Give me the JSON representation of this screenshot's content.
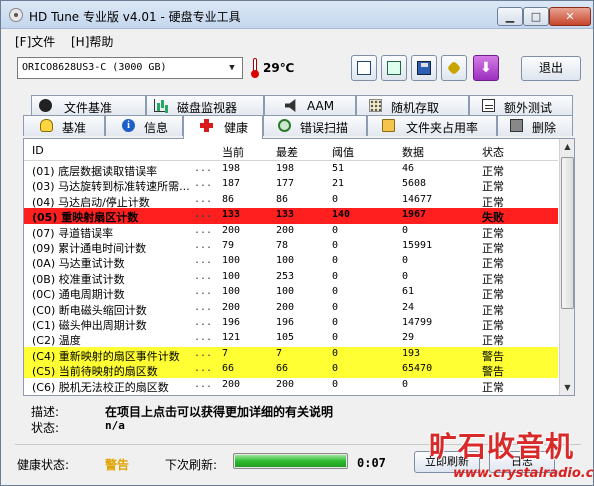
{
  "window": {
    "title": "HD Tune 专业版 v4.01 - 硬盘专业工具",
    "min_icon": "minimize-icon",
    "max_icon": "maximize-icon",
    "close_icon": "close-icon"
  },
  "menu": {
    "file": "[F]文件",
    "help": "[H]帮助"
  },
  "toolbar": {
    "drive": "ORICO8628US3-C (3000 GB)",
    "temperature": "29℃",
    "exit_label": "退出"
  },
  "tabs": {
    "row1": [
      "文件基准",
      "磁盘监视器",
      "AAM",
      "随机存取",
      "额外测试"
    ],
    "row2": [
      "基准",
      "信息",
      "健康",
      "错误扫描",
      "文件夹占用率",
      "删除"
    ],
    "active": "健康"
  },
  "health_table": {
    "columns": [
      "ID",
      "当前",
      "最差",
      "阈值",
      "数据",
      "状态"
    ],
    "rows": [
      {
        "id": "(01) 底层数据读取错误率",
        "dots": "...",
        "current": "198",
        "worst": "198",
        "threshold": "51",
        "data": "46",
        "status": "正常"
      },
      {
        "id": "(03) 马达旋转到标准转速所需...",
        "dots": "...",
        "current": "187",
        "worst": "177",
        "threshold": "21",
        "data": "5608",
        "status": "正常"
      },
      {
        "id": "(04) 马达启动/停止计数",
        "dots": "...",
        "current": "86",
        "worst": "86",
        "threshold": "0",
        "data": "14677",
        "status": "正常"
      },
      {
        "id": "(05) 重映射扇区计数",
        "dots": "...",
        "current": "133",
        "worst": "133",
        "threshold": "140",
        "data": "1967",
        "status": "失败"
      },
      {
        "id": "(07) 寻道错误率",
        "dots": "...",
        "current": "200",
        "worst": "200",
        "threshold": "0",
        "data": "0",
        "status": "正常"
      },
      {
        "id": "(09) 累计通电时间计数",
        "dots": "...",
        "current": "79",
        "worst": "78",
        "threshold": "0",
        "data": "15991",
        "status": "正常"
      },
      {
        "id": "(0A) 马达重试计数",
        "dots": "...",
        "current": "100",
        "worst": "100",
        "threshold": "0",
        "data": "0",
        "status": "正常"
      },
      {
        "id": "(0B) 校准重试计数",
        "dots": "...",
        "current": "100",
        "worst": "253",
        "threshold": "0",
        "data": "0",
        "status": "正常"
      },
      {
        "id": "(0C) 通电周期计数",
        "dots": "...",
        "current": "100",
        "worst": "100",
        "threshold": "0",
        "data": "61",
        "status": "正常"
      },
      {
        "id": "(C0) 断电磁头缩回计数",
        "dots": "...",
        "current": "200",
        "worst": "200",
        "threshold": "0",
        "data": "24",
        "status": "正常"
      },
      {
        "id": "(C1) 磁头伸出周期计数",
        "dots": "...",
        "current": "196",
        "worst": "196",
        "threshold": "0",
        "data": "14799",
        "status": "正常"
      },
      {
        "id": "(C2) 温度",
        "dots": "...",
        "current": "121",
        "worst": "105",
        "threshold": "0",
        "data": "29",
        "status": "正常"
      },
      {
        "id": "(C4) 重新映射的扇区事件计数",
        "dots": "...",
        "current": "7",
        "worst": "7",
        "threshold": "0",
        "data": "193",
        "status": "警告"
      },
      {
        "id": "(C5) 当前待映射的扇区数",
        "dots": "...",
        "current": "66",
        "worst": "66",
        "threshold": "0",
        "data": "65470",
        "status": "警告"
      },
      {
        "id": "(C6) 脱机无法校正的扇区数",
        "dots": "...",
        "current": "200",
        "worst": "200",
        "threshold": "0",
        "data": "0",
        "status": "正常"
      }
    ]
  },
  "details": {
    "desc_label": "描述:",
    "desc_text": "在项目上点击可以获得更加详细的有关说明",
    "state_label": "状态:",
    "state_text": "n/a"
  },
  "status": {
    "health_label": "健康状态:",
    "health_value": "警告",
    "health_color": "#e0a300",
    "refresh_label": "下次刷新:",
    "refresh_progress": 1.0,
    "refresh_time": "0:07",
    "refresh_button": "立即刷新",
    "log_button": "日志"
  },
  "watermark": {
    "title": "旷石收音机",
    "url": "www.crystalradio.cn"
  },
  "colors": {
    "failed_row": "#ff1f1f",
    "warn_row": "#ffff33"
  }
}
